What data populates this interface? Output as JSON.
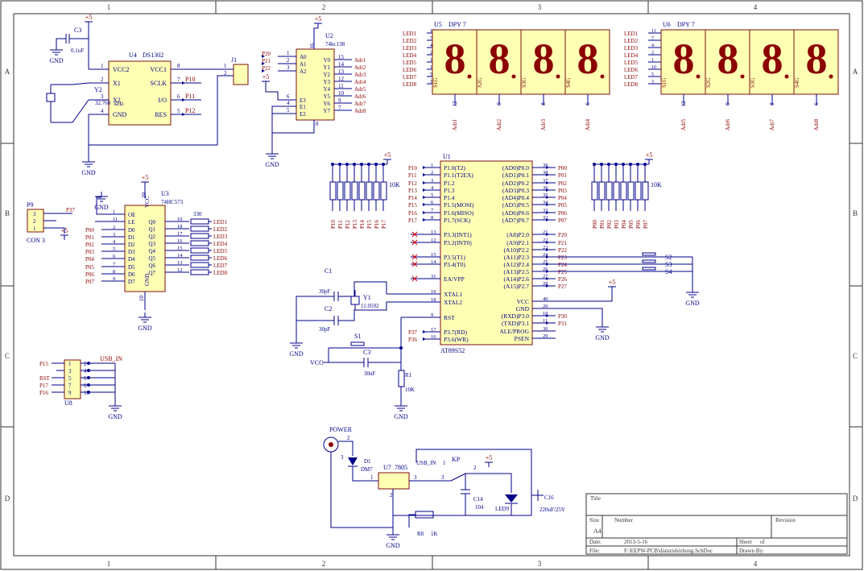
{
  "border": {
    "cols": [
      "1",
      "2",
      "3",
      "4"
    ],
    "rows": [
      "A",
      "B",
      "C",
      "D"
    ]
  },
  "u4": {
    "ref": "U4",
    "part": "DS1302",
    "pins": [
      "VCC2",
      "X1",
      "X2",
      "GND",
      "VCC1",
      "SCLK",
      "I/O",
      "RES"
    ],
    "nums": [
      "1",
      "2",
      "3",
      "4",
      "8",
      "7",
      "6",
      "5"
    ],
    "nets": [
      "P10",
      "P11",
      "P12"
    ]
  },
  "c3top": {
    "ref": "C3",
    "val": "0.1uF"
  },
  "y2": {
    "ref": "Y2",
    "val": "32.768",
    "unit": "kHz"
  },
  "j1": {
    "ref": "J1",
    "pins": [
      "1",
      "2"
    ]
  },
  "u2": {
    "ref": "U2",
    "part": "74hc138",
    "inputs": [
      "A0",
      "A1",
      "A2",
      "E3",
      "E1",
      "E2"
    ],
    "in_nums": [
      "1",
      "2",
      "3",
      "6",
      "4",
      "5"
    ],
    "in_nets": [
      "P20",
      "P21",
      "P22"
    ],
    "outputs": [
      "Y0",
      "Y1",
      "Y2",
      "Y3",
      "Y4",
      "Y5",
      "Y6",
      "Y7"
    ],
    "out_nums": [
      "15",
      "14",
      "13",
      "12",
      "11",
      "10",
      "9",
      "7"
    ],
    "adr": [
      "Adr1",
      "Adr2",
      "Adr3",
      "Adr4",
      "Adr5",
      "Adr6",
      "Adr7",
      "Adr8"
    ],
    "vcc": "VCC",
    "vcc_num": "16",
    "gnd": "GND",
    "gnd_num": "8"
  },
  "u5": {
    "ref": "U5",
    "part": "DPY 7",
    "leds": [
      "LED1",
      "LED2",
      "LED3",
      "LED4",
      "LED5",
      "LED6",
      "LED7",
      "LED8"
    ],
    "nums": [
      "11",
      "7",
      "4",
      "2",
      "1",
      "10",
      "5",
      "3"
    ],
    "segs": [
      "a",
      "b",
      "c",
      "d",
      "e",
      "f",
      "g",
      "dp"
    ],
    "sw": [
      "S1G",
      "S2G",
      "S3G",
      "S4G"
    ],
    "adr": [
      "Adr1",
      "Adr2",
      "Adr3",
      "Adr4"
    ],
    "adr_nums": [
      "12",
      "9",
      "8",
      "6"
    ],
    "digit": "8"
  },
  "u6": {
    "ref": "U6",
    "part": "DPY 7",
    "sw": [
      "S1G",
      "S2G",
      "S3G",
      "S4G"
    ],
    "adr": [
      "Adr5",
      "Adr6",
      "Adr7",
      "Adr8"
    ],
    "adr_nums": [
      "12",
      "9",
      "8",
      "6"
    ]
  },
  "rn1": {
    "val": "10K",
    "nets": [
      "P10",
      "P11",
      "P12",
      "P13",
      "P14",
      "P15",
      "P16",
      "P17"
    ]
  },
  "rn2": {
    "val": "10K",
    "nets": [
      "P00",
      "P01",
      "P02",
      "P03",
      "P04",
      "P05",
      "P06",
      "P07"
    ]
  },
  "u1": {
    "ref": "U1",
    "part": "AT89S52",
    "left": [
      "P1.0(T2)",
      "P1.1(T2EX)",
      "P1.2",
      "P1.3",
      "P1.4",
      "P1.5(MOSI)",
      "P1.6(MISO)",
      "P1.7(SCK)",
      "P3.3(INT1)",
      "P3.2(INT0)",
      "P3.5(T1)",
      "P3.4(T0)",
      "EA/VPP",
      "XTAL1",
      "XTAL2",
      "RST",
      "P3.7(RD)",
      "P3.6(WR)"
    ],
    "left_nums": [
      "1",
      "2",
      "3",
      "4",
      "5",
      "6",
      "7",
      "8",
      "13",
      "12",
      "15",
      "14",
      "31",
      "19",
      "18",
      "9",
      "17",
      "16"
    ],
    "left_nets": [
      "P10",
      "P11",
      "P12",
      "P13",
      "P14",
      "P15",
      "P16",
      "P17",
      "",
      "",
      "",
      "",
      "",
      "",
      "",
      "",
      "P37",
      "P36"
    ],
    "right": [
      "(AD0)P0.0",
      "(AD1)P0.1",
      "(AD2)P0.2",
      "(AD3)P0.3",
      "(AD4)P0.4",
      "(AD5)P0.5",
      "(AD6)P0.6",
      "(AD7)P0.7",
      "(A8)P2.0",
      "(A9)P2.1",
      "(A10)P2.2",
      "(A11)P2.3",
      "(A12)P2.4",
      "(A13)P2.5",
      "(A14)P2.6",
      "(A15)P2.7",
      "VCC",
      "GND",
      "(RXD)P3.0",
      "(TXD)P3.1",
      "ALE/PROG",
      "PSEN"
    ],
    "right_nums": [
      "39",
      "38",
      "37",
      "36",
      "35",
      "34",
      "33",
      "32",
      "21",
      "22",
      "23",
      "24",
      "25",
      "26",
      "27",
      "28",
      "40",
      "20",
      "10",
      "11",
      "30",
      "29"
    ],
    "right_nets": [
      "P00",
      "P01",
      "P02",
      "P03",
      "P04",
      "P05",
      "P06",
      "P07",
      "P20",
      "P21",
      "P22",
      "P23",
      "P24",
      "P25",
      "P26",
      "P27",
      "",
      "",
      "P30",
      "P31",
      "",
      ""
    ]
  },
  "p9": {
    "ref": "P9",
    "part": "CON 3",
    "pins": [
      "3",
      "2",
      "1"
    ],
    "net": "P37"
  },
  "u3": {
    "ref": "U3",
    "part": "74HC573",
    "in": [
      "OE",
      "LE",
      "D0",
      "D1",
      "D2",
      "D3",
      "D4",
      "D5",
      "D6",
      "D7"
    ],
    "in_nums": [
      "1",
      "11",
      "2",
      "3",
      "4",
      "5",
      "6",
      "7",
      "8",
      "9"
    ],
    "in_nets": [
      "P00",
      "P01",
      "P02",
      "P03",
      "P04",
      "P05",
      "P06",
      "P07"
    ],
    "out": [
      "Q0",
      "Q1",
      "Q2",
      "Q3",
      "Q4",
      "Q5",
      "Q6",
      "Q7"
    ],
    "out_nums": [
      "19",
      "18",
      "17",
      "16",
      "15",
      "14",
      "13",
      "12"
    ],
    "vcc": "VCC",
    "vcc_num": "20",
    "gnd": "GND",
    "gnd_num": "10",
    "res": "330",
    "leds": [
      "LED1",
      "LED2",
      "LED3",
      "LED4",
      "LED5",
      "LED6",
      "LED7",
      "LED8"
    ]
  },
  "osc": {
    "c1": "C1",
    "c1v": "30pF",
    "c2": "C2",
    "c2v": "30pF",
    "y1": "Y1",
    "y1v": "11.0592"
  },
  "reset": {
    "s1": "S1",
    "c3": "C3",
    "c3v": "30uF",
    "r1": "R1",
    "r1v": "10K",
    "vcc": "VCC"
  },
  "keys": [
    "S2",
    "S3",
    "S4"
  ],
  "u8": {
    "ref": "U8",
    "pins": [
      "1",
      "2",
      "3",
      "4",
      "5",
      "6",
      "7",
      "8",
      "9",
      "10"
    ],
    "label": "USB_IN",
    "nets": [
      "P15",
      "RST",
      "P17",
      "P16"
    ]
  },
  "power": {
    "title": "POWER",
    "d1": "D1",
    "d1p": "DM7",
    "u7": "U7",
    "u7p": "7805",
    "u7pins": [
      "1",
      "2",
      "3"
    ],
    "usb": "USB_IN",
    "kp": "KP",
    "kpnums": [
      "1",
      "2",
      "3"
    ],
    "c14": "C14",
    "c14v": "104",
    "led9": "LED9",
    "r8": "R8",
    "r8v": "1K",
    "c16": "C16",
    "c16v": "220uF/25V",
    "pnums": [
      "2",
      "3"
    ]
  },
  "sym": {
    "p5": "+5",
    "gnd": "GND"
  },
  "title": {
    "title": "Title",
    "size": "Size",
    "size_v": "A4",
    "number": "Number",
    "revision": "Revision",
    "date": "Date:",
    "date_v": "2013-5-16",
    "sheet": "Sheet",
    "of": "of",
    "file": "File:",
    "file_v": "F:\\EEPW-PCB\\dianzishizhong.SchDoc",
    "drawn": "Drawn By:"
  }
}
